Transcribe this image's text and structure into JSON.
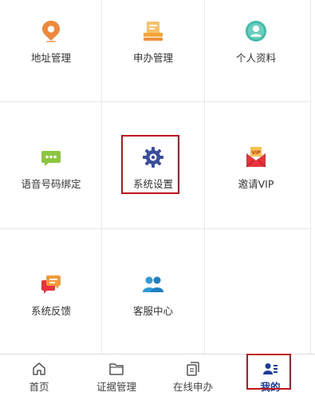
{
  "grid": {
    "items": [
      {
        "label": "地址管理",
        "icon": "location-pin-icon",
        "color": "#f0883b"
      },
      {
        "label": "申办管理",
        "icon": "document-stack-icon",
        "color": "#f3a53a"
      },
      {
        "label": "个人资料",
        "icon": "user-profile-icon",
        "color": "#3dbfa7"
      },
      {
        "label": "语音号码绑定",
        "icon": "chat-bubble-icon",
        "color": "#8cc63f"
      },
      {
        "label": "系统设置",
        "icon": "gear-icon",
        "color": "#3a4ea0"
      },
      {
        "label": "邀请VIP",
        "icon": "vip-envelope-icon",
        "color": "#e8333c"
      },
      {
        "label": "系统反馈",
        "icon": "feedback-icon",
        "color": "#e8333c"
      },
      {
        "label": "客服中心",
        "icon": "customer-service-icon",
        "color": "#2f9ad8"
      }
    ]
  },
  "tabbar": {
    "tabs": [
      {
        "label": "首页",
        "icon": "home-icon"
      },
      {
        "label": "证据管理",
        "icon": "folder-icon"
      },
      {
        "label": "在线申办",
        "icon": "documents-icon"
      },
      {
        "label": "我的",
        "icon": "profile-card-icon",
        "active": true
      }
    ]
  },
  "colors": {
    "highlight": "#c0151d",
    "active_tab": "#1a3d9b",
    "divider": "#e8e8e8"
  }
}
